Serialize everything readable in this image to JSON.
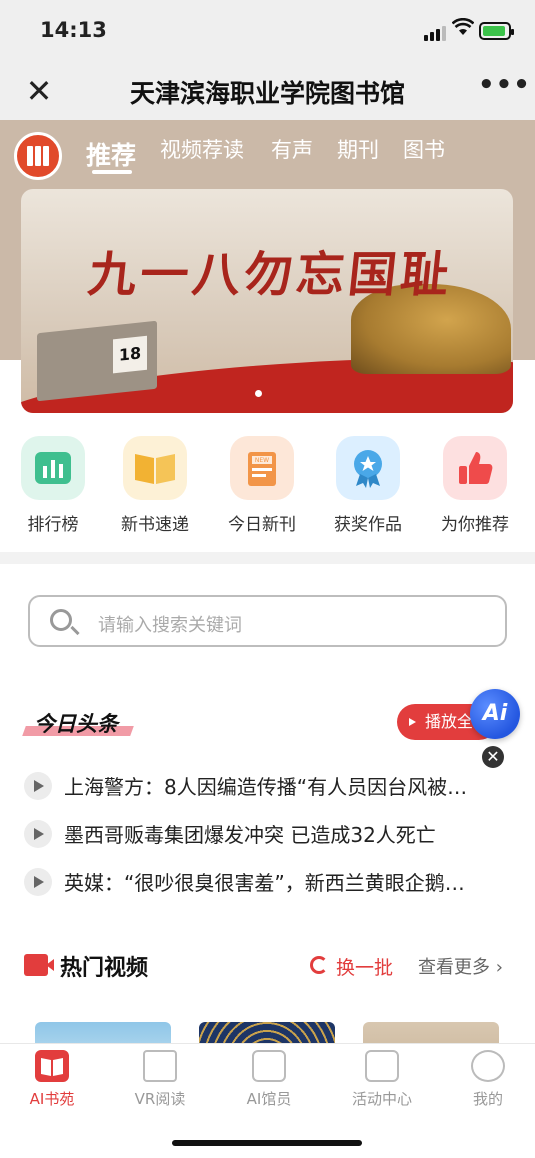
{
  "status": {
    "time": "14:13"
  },
  "nav": {
    "title": "天津滨海职业学院图书馆",
    "close_icon": "close-icon",
    "more_icon": "more-icon"
  },
  "tabs": [
    {
      "label": "推荐",
      "active": true
    },
    {
      "label": "视频荐读"
    },
    {
      "label": "有声"
    },
    {
      "label": "期刊"
    },
    {
      "label": "图书"
    }
  ],
  "banner": {
    "title": "九一八勿忘国耻",
    "calendar_number": "18"
  },
  "quick_entries": [
    {
      "label": "排行榜",
      "icon": "chart-icon",
      "color": "#3fbf8f"
    },
    {
      "label": "新书速递",
      "icon": "book-icon",
      "color": "#f2b233"
    },
    {
      "label": "今日新刊",
      "icon": "new-magazine-icon",
      "color": "#f29548"
    },
    {
      "label": "获奖作品",
      "icon": "award-icon",
      "color": "#4aa8e8"
    },
    {
      "label": "为你推荐",
      "icon": "thumbs-up-icon",
      "color": "#ef4b4b"
    }
  ],
  "search": {
    "placeholder": "请输入搜索关键词"
  },
  "headlines": {
    "title": "今日头条",
    "play_all": "播放全",
    "ai_fab": "Ai",
    "items": [
      "上海警方：8人因编造传播“有人员因台风被…",
      "墨西哥贩毒集团爆发冲突 已造成32人死亡",
      "英媒：“很吵很臭很害羞”，新西兰黄眼企鹅…"
    ]
  },
  "hot_videos": {
    "title": "热门视频",
    "refresh": "换一批",
    "see_more": "查看更多"
  },
  "bottom_tabs": [
    {
      "label": "AI书苑",
      "icon": "book-open-icon",
      "active": true
    },
    {
      "label": "VR阅读",
      "icon": "cube-icon"
    },
    {
      "label": "AI馆员",
      "icon": "chip-icon"
    },
    {
      "label": "活动中心",
      "icon": "calendar-star-icon"
    },
    {
      "label": "我的",
      "icon": "user-icon"
    }
  ],
  "colors": {
    "accent": "#e23d3d",
    "header_bg": "#cbb9a8"
  }
}
